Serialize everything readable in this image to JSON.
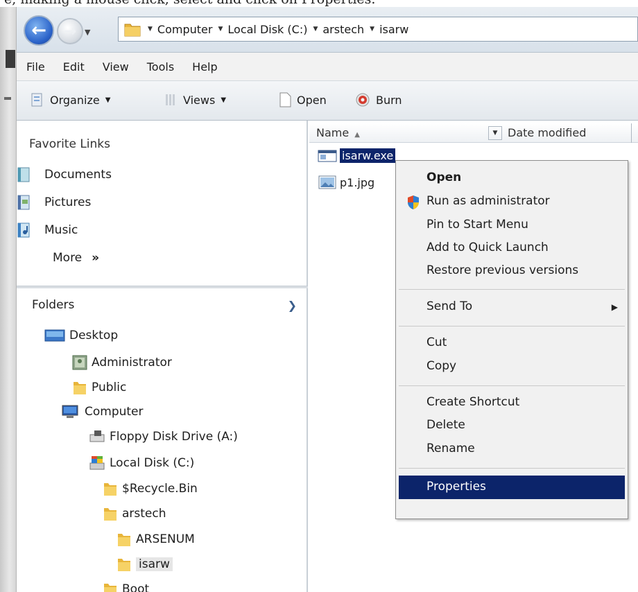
{
  "caption": "e, making a mouse click, select and click on Properties.",
  "address": {
    "crumbs": [
      "Computer",
      "Local Disk (C:)",
      "arstech",
      "isarw"
    ]
  },
  "menubar": [
    "File",
    "Edit",
    "View",
    "Tools",
    "Help"
  ],
  "toolbar": {
    "organize": "Organize",
    "views": "Views",
    "open": "Open",
    "burn": "Burn"
  },
  "navpane": {
    "favorites_title": "Favorite Links",
    "favorites": [
      "Documents",
      "Pictures",
      "Music"
    ],
    "more": "More",
    "more_glyph": "»",
    "folders_title": "Folders",
    "tree": [
      "Desktop",
      "Administrator",
      "Public",
      "Computer",
      "Floppy Disk Drive (A:)",
      "Local Disk (C:)",
      "$Recycle.Bin",
      "arstech",
      "ARSENUM",
      "isarw",
      "Boot"
    ]
  },
  "filelist": {
    "col_name": "Name",
    "col_date": "Date modified",
    "files": [
      "isarw.exe",
      "p1.jpg"
    ]
  },
  "context_menu": {
    "open": "Open",
    "run_as": "Run as administrator",
    "pin": "Pin to Start Menu",
    "quick_launch": "Add to Quick Launch",
    "restore": "Restore previous versions",
    "send_to": "Send To",
    "cut": "Cut",
    "copy": "Copy",
    "create_shortcut": "Create Shortcut",
    "delete": "Delete",
    "rename": "Rename",
    "properties": "Properties"
  },
  "colors": {
    "selection": "#0c246a",
    "menu_bg": "#f1f1f1",
    "folder": "#e8b53a"
  },
  "icons": [
    "back-arrow-icon",
    "forward-arrow-icon",
    "folder-icon",
    "organize-icon",
    "views-icon",
    "open-file-icon",
    "burn-icon",
    "documents-icon",
    "pictures-icon",
    "music-icon",
    "desktop-icon",
    "user-icon",
    "computer-icon",
    "floppy-drive-icon",
    "local-disk-icon",
    "exe-file-icon",
    "jpg-file-icon",
    "uac-shield-icon"
  ]
}
